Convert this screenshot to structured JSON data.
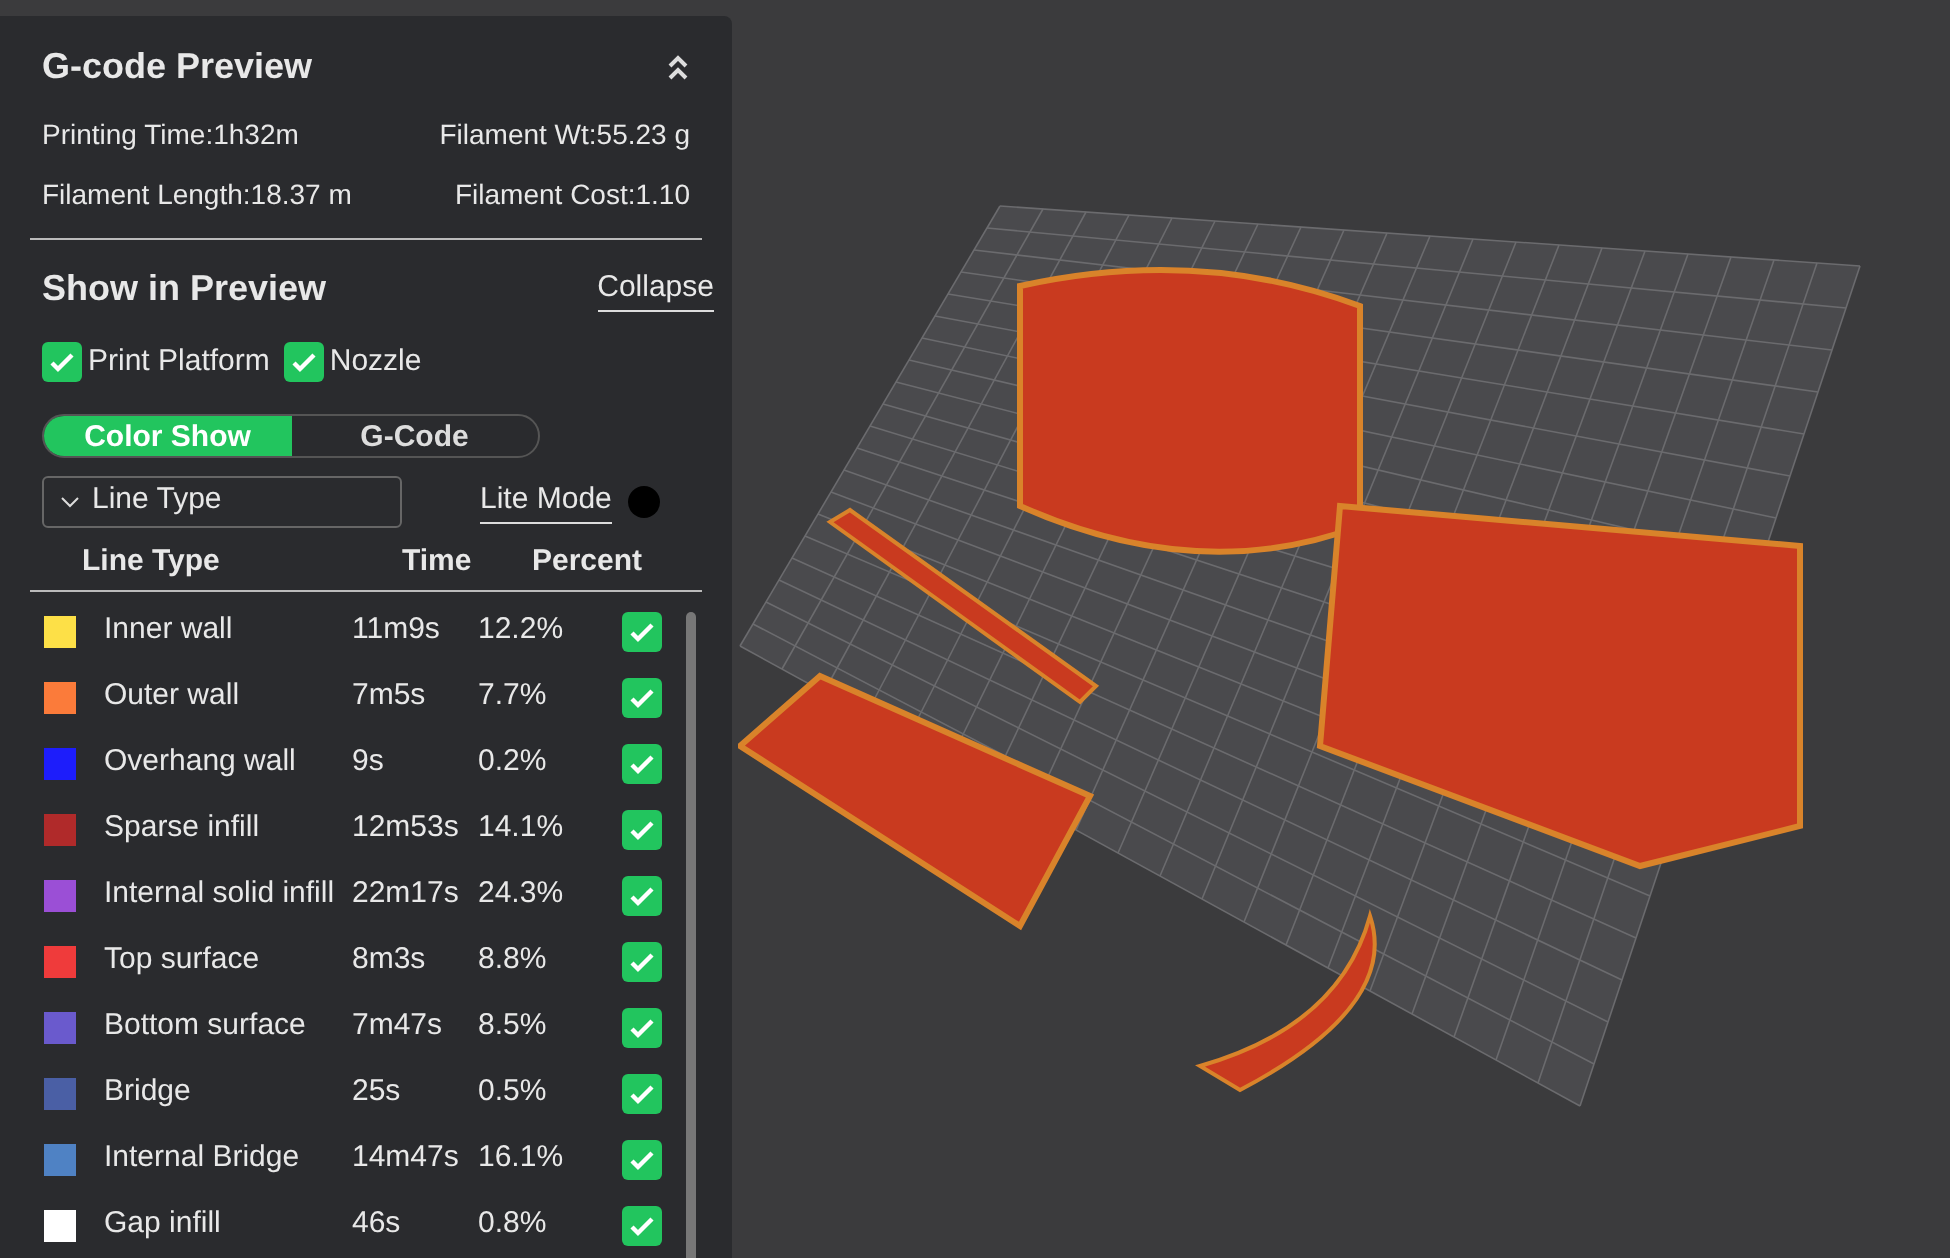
{
  "panel": {
    "title": "G-code Preview",
    "stats": [
      "Printing Time:1h32m",
      "Filament Wt:55.23 g",
      "Filament Length:18.37 m",
      "Filament Cost:1.10"
    ]
  },
  "show_in_preview": {
    "title": "Show in Preview",
    "collapse": "Collapse",
    "checkboxes": [
      {
        "label": "Print Platform",
        "checked": true
      },
      {
        "label": "Nozzle",
        "checked": true
      }
    ],
    "view_tabs": [
      {
        "label": "Color Show",
        "selected": true
      },
      {
        "label": "G-Code",
        "selected": false
      }
    ],
    "dropdown": {
      "value": "Line Type"
    },
    "lite_mode": {
      "label": "Lite Mode",
      "on": false
    }
  },
  "table": {
    "columns": [
      "Line Type",
      "Time",
      "Percent"
    ],
    "rows": [
      {
        "name": "Inner wall",
        "time": "11m9s",
        "percent": "12.2%",
        "color": "#fde047",
        "checked": true
      },
      {
        "name": "Outer wall",
        "time": "7m5s",
        "percent": "7.7%",
        "color": "#fb7b3a",
        "checked": true
      },
      {
        "name": "Overhang wall",
        "time": "9s",
        "percent": "0.2%",
        "color": "#1d1dfb",
        "checked": true
      },
      {
        "name": "Sparse infill",
        "time": "12m53s",
        "percent": "14.1%",
        "color": "#b02a2a",
        "checked": true
      },
      {
        "name": "Internal solid infill",
        "time": "22m17s",
        "percent": "24.3%",
        "color": "#9b4fd6",
        "checked": true
      },
      {
        "name": "Top surface",
        "time": "8m3s",
        "percent": "8.8%",
        "color": "#ef3b3b",
        "checked": true
      },
      {
        "name": "Bottom surface",
        "time": "7m47s",
        "percent": "8.5%",
        "color": "#6a5acd",
        "checked": true
      },
      {
        "name": "Bridge",
        "time": "25s",
        "percent": "0.5%",
        "color": "#4a5fa5",
        "checked": true
      },
      {
        "name": "Internal Bridge",
        "time": "14m47s",
        "percent": "16.1%",
        "color": "#4f82c4",
        "checked": true
      },
      {
        "name": "Gap infill",
        "time": "46s",
        "percent": "0.8%",
        "color": "#ffffff",
        "checked": true
      }
    ]
  }
}
